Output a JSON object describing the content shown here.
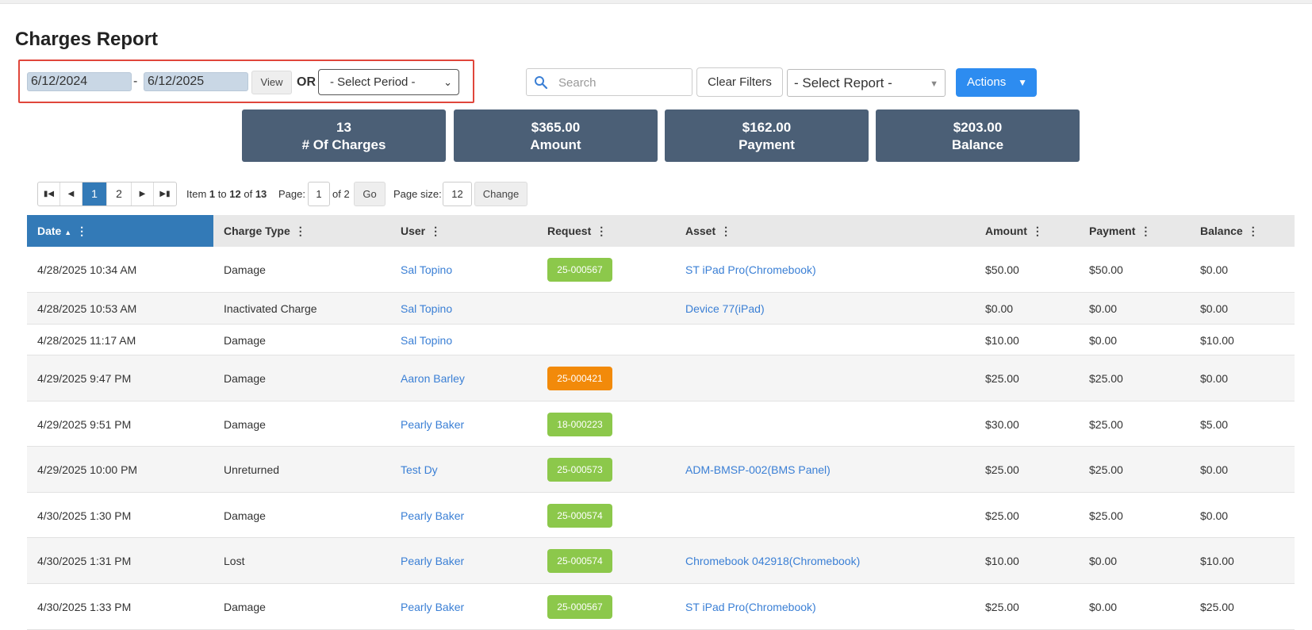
{
  "page": {
    "title": "Charges Report"
  },
  "filters": {
    "start_date": "6/12/2024",
    "separator": "-",
    "end_date": "6/12/2025",
    "view_label": "View",
    "or_label": "OR",
    "period_select": "- Select Period -"
  },
  "toolbar": {
    "search_placeholder": "Search",
    "clear_filters": "Clear Filters",
    "report_select": "- Select Report -",
    "actions": "Actions"
  },
  "summary": [
    {
      "value": "13",
      "label": "# Of Charges"
    },
    {
      "value": "$365.00",
      "label": "Amount"
    },
    {
      "value": "$162.00",
      "label": "Payment"
    },
    {
      "value": "$203.00",
      "label": "Balance"
    }
  ],
  "pager": {
    "pages": [
      "1",
      "2"
    ],
    "item_label": "Item",
    "item_from": "1",
    "to_label": "to",
    "item_to": "12",
    "of_label": "of",
    "total": "13",
    "page_label": "Page:",
    "page_value": "1",
    "page_of": "of 2",
    "go": "Go",
    "size_label": "Page size:",
    "size_value": "12",
    "change": "Change"
  },
  "table": {
    "columns": [
      "Date",
      "Charge Type",
      "User",
      "Request",
      "Asset",
      "Amount",
      "Payment",
      "Balance"
    ],
    "rows": [
      {
        "date": "4/28/2025 10:34 AM",
        "type": "Damage",
        "user": "Sal Topino",
        "request": "25-000567",
        "request_color": "green",
        "asset": "ST iPad Pro(Chromebook)",
        "amount": "$50.00",
        "payment": "$50.00",
        "balance": "$0.00"
      },
      {
        "date": "4/28/2025 10:53 AM",
        "type": "Inactivated Charge",
        "user": "Sal Topino",
        "request": "",
        "request_color": "",
        "asset": "Device 77(iPad)",
        "amount": "$0.00",
        "payment": "$0.00",
        "balance": "$0.00"
      },
      {
        "date": "4/28/2025 11:17 AM",
        "type": "Damage",
        "user": "Sal Topino",
        "request": "",
        "request_color": "",
        "asset": "",
        "amount": "$10.00",
        "payment": "$0.00",
        "balance": "$10.00"
      },
      {
        "date": "4/29/2025 9:47 PM",
        "type": "Damage",
        "user": "Aaron Barley",
        "request": "25-000421",
        "request_color": "orange",
        "asset": "",
        "amount": "$25.00",
        "payment": "$25.00",
        "balance": "$0.00"
      },
      {
        "date": "4/29/2025 9:51 PM",
        "type": "Damage",
        "user": "Pearly Baker",
        "request": "18-000223",
        "request_color": "green",
        "asset": "",
        "amount": "$30.00",
        "payment": "$25.00",
        "balance": "$5.00"
      },
      {
        "date": "4/29/2025 10:00 PM",
        "type": "Unreturned",
        "user": "Test Dy",
        "request": "25-000573",
        "request_color": "green",
        "asset": "ADM-BMSP-002(BMS Panel)",
        "amount": "$25.00",
        "payment": "$25.00",
        "balance": "$0.00"
      },
      {
        "date": "4/30/2025 1:30 PM",
        "type": "Damage",
        "user": "Pearly Baker",
        "request": "25-000574",
        "request_color": "green",
        "asset": "",
        "amount": "$25.00",
        "payment": "$25.00",
        "balance": "$0.00"
      },
      {
        "date": "4/30/2025 1:31 PM",
        "type": "Lost",
        "user": "Pearly Baker",
        "request": "25-000574",
        "request_color": "green",
        "asset": "Chromebook 042918(Chromebook)",
        "amount": "$10.00",
        "payment": "$0.00",
        "balance": "$10.00"
      },
      {
        "date": "4/30/2025 1:33 PM",
        "type": "Damage",
        "user": "Pearly Baker",
        "request": "25-000567",
        "request_color": "green",
        "asset": "ST iPad Pro(Chromebook)",
        "amount": "$25.00",
        "payment": "$0.00",
        "balance": "$25.00"
      }
    ]
  }
}
